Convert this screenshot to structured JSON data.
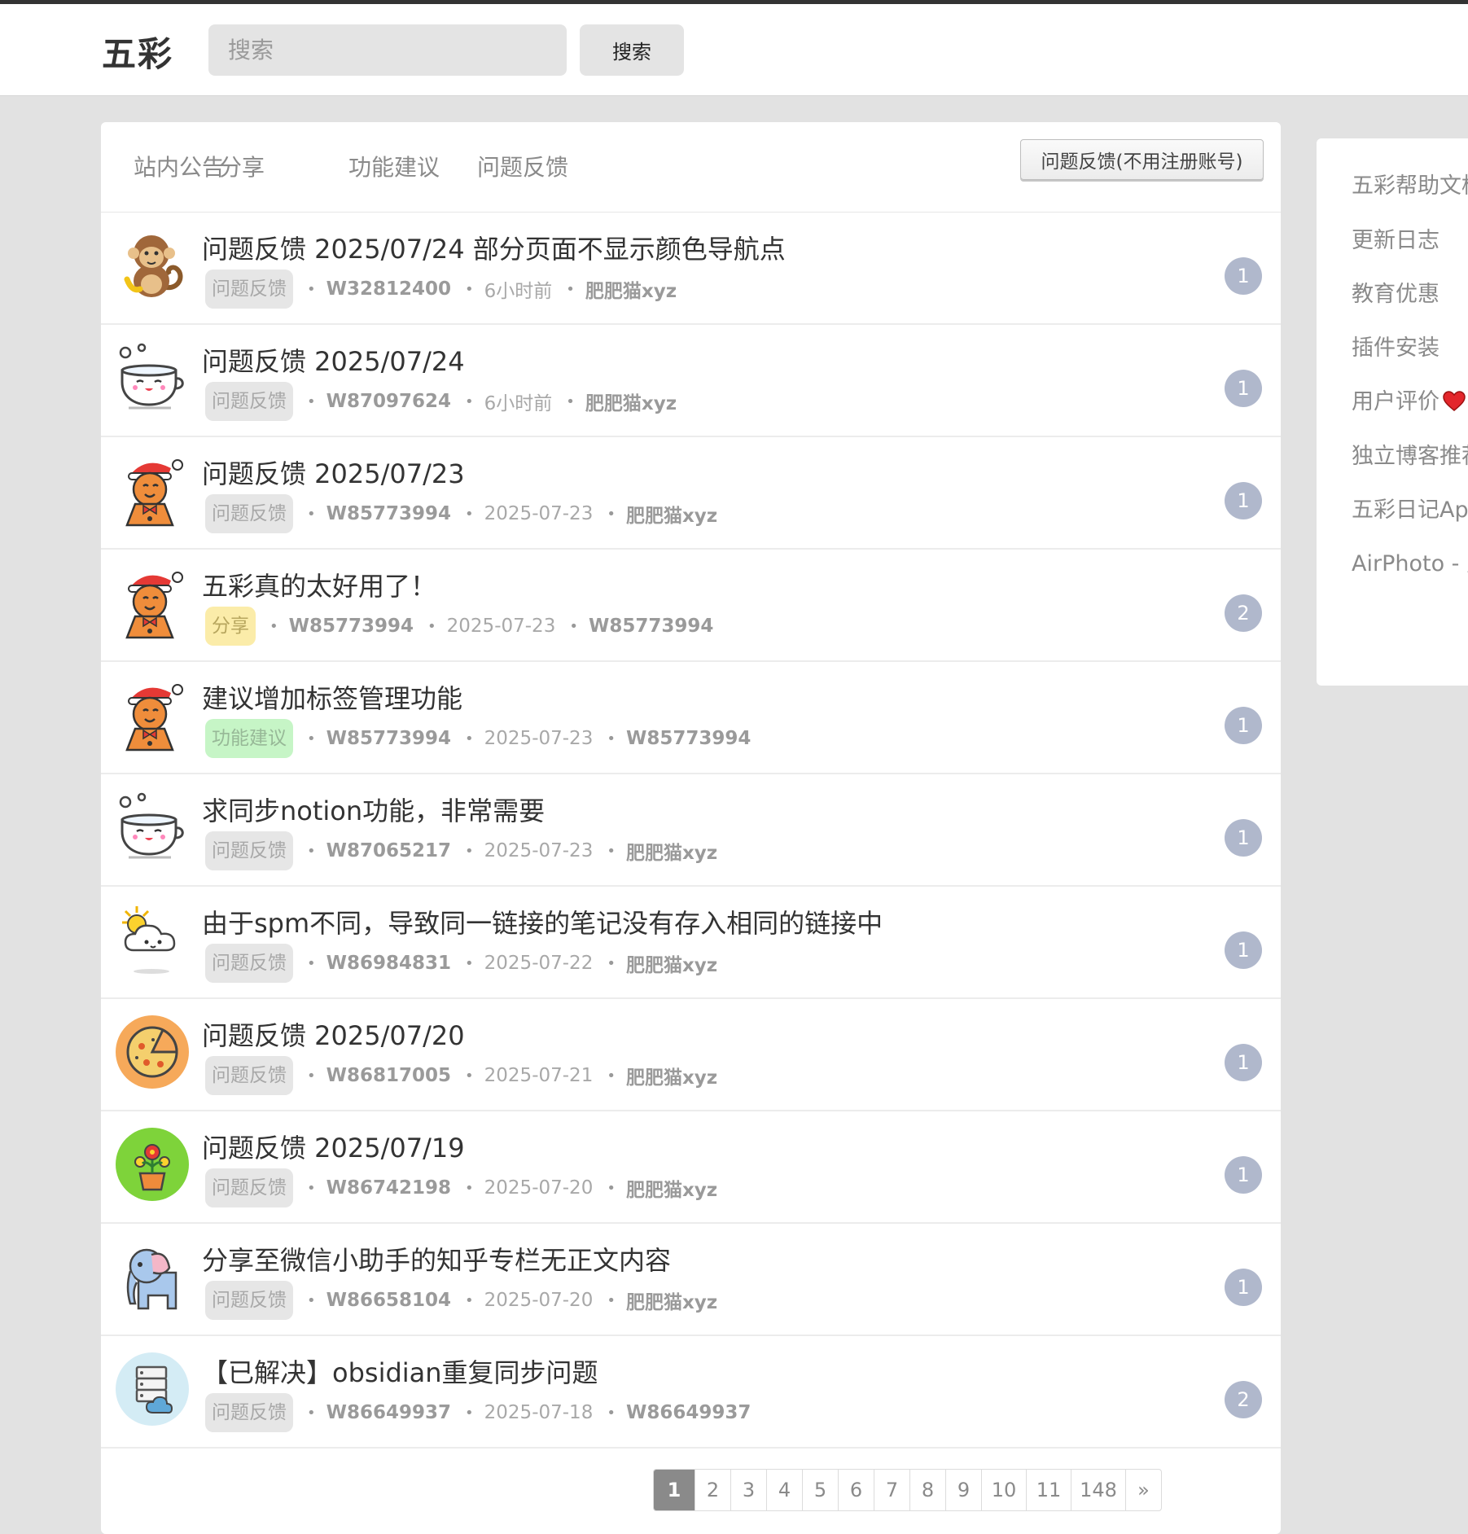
{
  "header": {
    "brand": "五彩",
    "search_placeholder": "搜索",
    "search_button": "搜索"
  },
  "tabs": [
    "站内公告",
    "分享",
    "功能建议",
    "问题反馈"
  ],
  "feedback_button": "问题反馈(不用注册账号)",
  "topics": [
    {
      "title": "问题反馈 2025/07/24 部分页面不显示颜色导航点",
      "tag": "问题反馈",
      "tag_style": "gray",
      "author": "W32812400",
      "time": "6小时前",
      "last_reply": "肥肥猫xyz",
      "replies": "1",
      "avatar": "monkey-icon"
    },
    {
      "title": "问题反馈 2025/07/24",
      "tag": "问题反馈",
      "tag_style": "gray",
      "author": "W87097624",
      "time": "6小时前",
      "last_reply": "肥肥猫xyz",
      "replies": "1",
      "avatar": "teacup-icon"
    },
    {
      "title": "问题反馈 2025/07/23",
      "tag": "问题反馈",
      "tag_style": "gray",
      "author": "W85773994",
      "time": "2025-07-23",
      "last_reply": "肥肥猫xyz",
      "replies": "1",
      "avatar": "gingerbread-icon"
    },
    {
      "title": "五彩真的太好用了！",
      "tag": "分享",
      "tag_style": "yellow",
      "author": "W85773994",
      "time": "2025-07-23",
      "last_reply": "W85773994",
      "replies": "2",
      "avatar": "gingerbread-icon"
    },
    {
      "title": "建议增加标签管理功能",
      "tag": "功能建议",
      "tag_style": "green",
      "author": "W85773994",
      "time": "2025-07-23",
      "last_reply": "W85773994",
      "replies": "1",
      "avatar": "gingerbread-icon"
    },
    {
      "title": "求同步notion功能，非常需要",
      "tag": "问题反馈",
      "tag_style": "gray",
      "author": "W87065217",
      "time": "2025-07-23",
      "last_reply": "肥肥猫xyz",
      "replies": "1",
      "avatar": "teacup-icon"
    },
    {
      "title": "由于spm不同，导致同一链接的笔记没有存入相同的链接中",
      "tag": "问题反馈",
      "tag_style": "gray",
      "author": "W86984831",
      "time": "2025-07-22",
      "last_reply": "肥肥猫xyz",
      "replies": "1",
      "avatar": "sun-cloud-icon"
    },
    {
      "title": "问题反馈 2025/07/20",
      "tag": "问题反馈",
      "tag_style": "gray",
      "author": "W86817005",
      "time": "2025-07-21",
      "last_reply": "肥肥猫xyz",
      "replies": "1",
      "avatar": "pizza-icon"
    },
    {
      "title": "问题反馈 2025/07/19",
      "tag": "问题反馈",
      "tag_style": "gray",
      "author": "W86742198",
      "time": "2025-07-20",
      "last_reply": "肥肥猫xyz",
      "replies": "1",
      "avatar": "flower-pot-icon"
    },
    {
      "title": "分享至微信小助手的知乎专栏无正文内容",
      "tag": "问题反馈",
      "tag_style": "gray",
      "author": "W86658104",
      "time": "2025-07-20",
      "last_reply": "肥肥猫xyz",
      "replies": "1",
      "avatar": "elephant-icon"
    },
    {
      "title": "【已解决】obsidian重复同步问题",
      "tag": "问题反馈",
      "tag_style": "gray",
      "author": "W86649937",
      "time": "2025-07-18",
      "last_reply": "W86649937",
      "replies": "2",
      "avatar": "cloud-server-icon"
    }
  ],
  "pagination": {
    "pages": [
      "1",
      "2",
      "3",
      "4",
      "5",
      "6",
      "7",
      "8",
      "9",
      "10",
      "11",
      "148",
      "»"
    ],
    "current": "1"
  },
  "sidebar": {
    "links": [
      "五彩帮助文档",
      "更新日志",
      "教育优惠",
      "插件安装",
      "用户评价",
      "独立博客推荐",
      "五彩日记App",
      "AirPhoto - 照片"
    ],
    "heart_after": "用户评价"
  },
  "colors": {
    "badge": "#b0b8cc",
    "tag_gray": "#e6e6e6",
    "tag_yellow": "#fbeca9",
    "tag_green": "#c6f5c6",
    "page_active": "#8a8a8a"
  }
}
